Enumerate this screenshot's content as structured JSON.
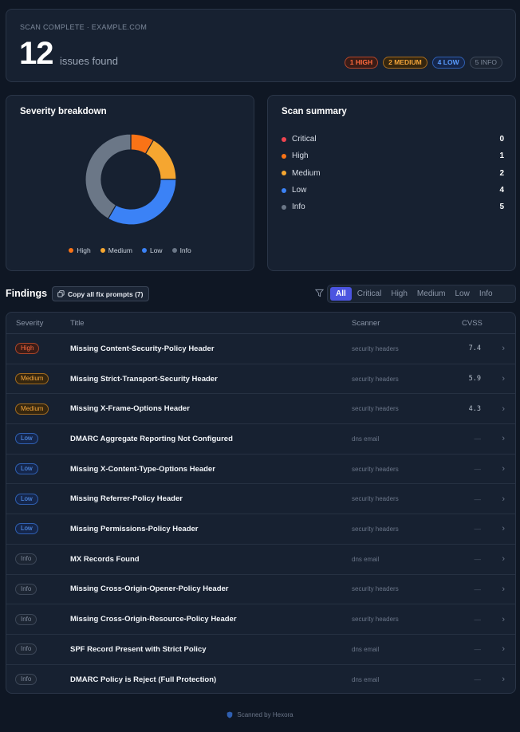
{
  "header": {
    "eyebrow": "SCAN COMPLETE · EXAMPLE.COM",
    "count": "12",
    "count_label": "issues found",
    "pills": [
      {
        "label": "1 HIGH",
        "kind": "high"
      },
      {
        "label": "2 MEDIUM",
        "kind": "medium"
      },
      {
        "label": "4 LOW",
        "kind": "low"
      },
      {
        "label": "5 INFO",
        "kind": "info"
      }
    ]
  },
  "colors": {
    "critical": "#ef4450",
    "high": "#f97316",
    "medium": "#f5a630",
    "low": "#3b82f6",
    "info": "#6b7787",
    "accent": "#4b54e0"
  },
  "severity_breakdown": {
    "title": "Severity breakdown",
    "legend": [
      "High",
      "Medium",
      "Low",
      "Info"
    ]
  },
  "chart_data": {
    "type": "pie",
    "categories": [
      "High",
      "Medium",
      "Low",
      "Info"
    ],
    "values": [
      1,
      2,
      4,
      5
    ],
    "title": "Severity breakdown",
    "legend": "bottom"
  },
  "summary": {
    "title": "Scan summary",
    "rows": [
      {
        "label": "Critical",
        "value": "0",
        "kind": "critical"
      },
      {
        "label": "High",
        "value": "1",
        "kind": "high"
      },
      {
        "label": "Medium",
        "value": "2",
        "kind": "medium"
      },
      {
        "label": "Low",
        "value": "4",
        "kind": "low"
      },
      {
        "label": "Info",
        "value": "5",
        "kind": "info"
      }
    ]
  },
  "findings": {
    "title": "Findings",
    "copy_label": "Copy all fix prompts (7)",
    "tabs": [
      "All",
      "Critical",
      "High",
      "Medium",
      "Low",
      "Info"
    ],
    "active_tab": "All",
    "columns": {
      "severity": "Severity",
      "title": "Title",
      "scanner": "Scanner",
      "cvss": "CVSS"
    },
    "rows": [
      {
        "severity": "High",
        "title": "Missing Content-Security-Policy Header",
        "scanner": "security headers",
        "cvss": "7.4"
      },
      {
        "severity": "Medium",
        "title": "Missing Strict-Transport-Security Header",
        "scanner": "security headers",
        "cvss": "5.9"
      },
      {
        "severity": "Medium",
        "title": "Missing X-Frame-Options Header",
        "scanner": "security headers",
        "cvss": "4.3"
      },
      {
        "severity": "Low",
        "title": "DMARC Aggregate Reporting Not Configured",
        "scanner": "dns email",
        "cvss": "—"
      },
      {
        "severity": "Low",
        "title": "Missing X-Content-Type-Options Header",
        "scanner": "security headers",
        "cvss": "—"
      },
      {
        "severity": "Low",
        "title": "Missing Referrer-Policy Header",
        "scanner": "security headers",
        "cvss": "—"
      },
      {
        "severity": "Low",
        "title": "Missing Permissions-Policy Header",
        "scanner": "security headers",
        "cvss": "—"
      },
      {
        "severity": "Info",
        "title": "MX Records Found",
        "scanner": "dns email",
        "cvss": "—"
      },
      {
        "severity": "Info",
        "title": "Missing Cross-Origin-Opener-Policy Header",
        "scanner": "security headers",
        "cvss": "—"
      },
      {
        "severity": "Info",
        "title": "Missing Cross-Origin-Resource-Policy Header",
        "scanner": "security headers",
        "cvss": "—"
      },
      {
        "severity": "Info",
        "title": "SPF Record Present with Strict Policy",
        "scanner": "dns email",
        "cvss": "—"
      },
      {
        "severity": "Info",
        "title": "DMARC Policy is Reject (Full Protection)",
        "scanner": "dns email",
        "cvss": "—"
      }
    ]
  },
  "footer": {
    "text": "Scanned by Hexora"
  }
}
